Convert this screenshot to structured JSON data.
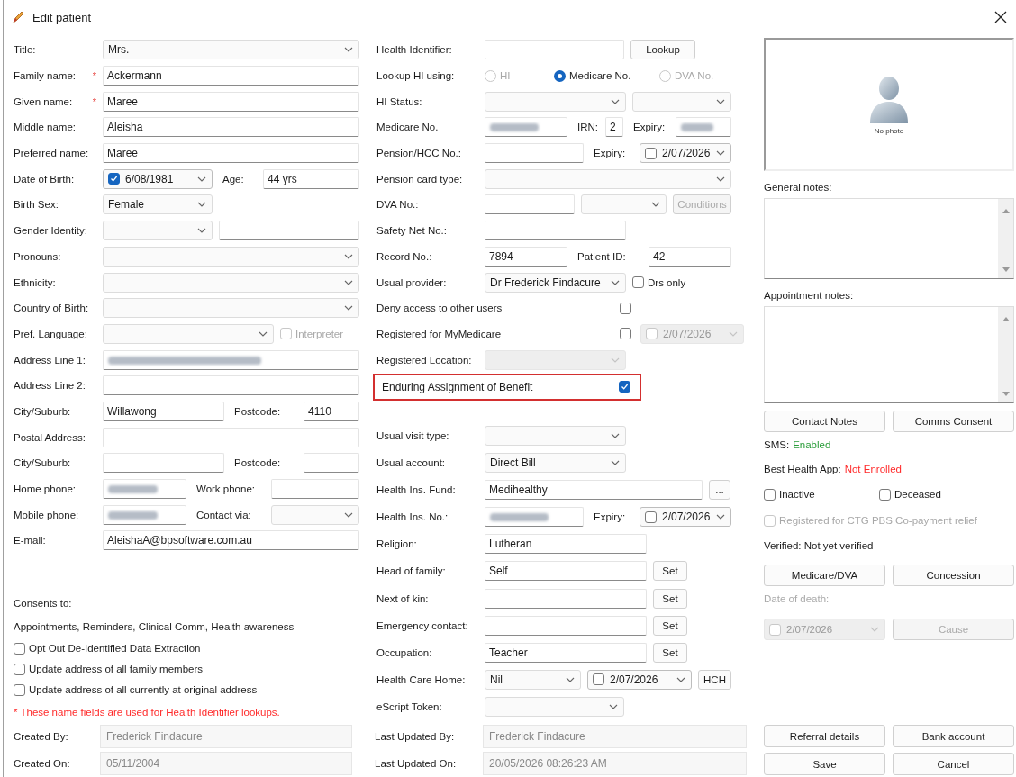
{
  "window": {
    "title": "Edit patient"
  },
  "personal": {
    "rows": [
      {
        "label": "Title:",
        "items": [
          {
            "kind": "combo",
            "value": "Mrs."
          }
        ]
      },
      {
        "label": "Family name:",
        "marker": "*",
        "items": [
          {
            "kind": "text",
            "value": "Ackermann"
          }
        ]
      },
      {
        "label": "Given name:",
        "marker": "*",
        "items": [
          {
            "kind": "text",
            "value": "Maree"
          }
        ]
      },
      {
        "label": "Middle name:",
        "items": [
          {
            "kind": "text",
            "value": "Aleisha"
          }
        ]
      },
      {
        "label": "Preferred name:",
        "items": [
          {
            "kind": "text",
            "value": "Maree"
          }
        ]
      },
      {
        "label": "Date of Birth:",
        "items": [
          {
            "kind": "date",
            "checked": true,
            "value": "6/08/1981"
          },
          {
            "kind": "label",
            "text": "Age:"
          },
          {
            "kind": "text",
            "value": "44 yrs"
          }
        ]
      },
      {
        "label": "Birth Sex:",
        "items": [
          {
            "kind": "combo",
            "value": "Female"
          }
        ]
      },
      {
        "label": "Gender Identity:",
        "items": [
          {
            "kind": "combo"
          },
          {
            "kind": "text"
          }
        ]
      },
      {
        "label": "Pronouns:",
        "items": [
          {
            "kind": "combo"
          }
        ]
      },
      {
        "label": "Ethnicity:",
        "items": [
          {
            "kind": "combo"
          }
        ]
      },
      {
        "label": "Country of Birth:",
        "items": [
          {
            "kind": "combo"
          }
        ]
      },
      {
        "label": "Pref. Language:",
        "items": [
          {
            "kind": "combo"
          },
          {
            "kind": "check",
            "label": "Interpreter",
            "checked": false,
            "disabled": true
          }
        ]
      },
      {
        "label": "Address Line 1:",
        "items": [
          {
            "kind": "text",
            "redacted": true
          }
        ]
      },
      {
        "label": "Address Line 2:",
        "items": [
          {
            "kind": "text"
          }
        ]
      },
      {
        "label": "City/Suburb:",
        "items": [
          {
            "kind": "text",
            "value": "Willawong"
          },
          {
            "kind": "label",
            "text": "Postcode:"
          },
          {
            "kind": "text",
            "value": "4110"
          }
        ]
      },
      {
        "label": "Postal Address:",
        "items": [
          {
            "kind": "text"
          }
        ]
      },
      {
        "label": "City/Suburb:",
        "items": [
          {
            "kind": "text"
          },
          {
            "kind": "label",
            "text": "Postcode:"
          },
          {
            "kind": "text"
          }
        ]
      },
      {
        "label": "Home phone:",
        "items": [
          {
            "kind": "text",
            "redacted": true
          },
          {
            "kind": "label",
            "text": "Work phone:"
          },
          {
            "kind": "text"
          }
        ]
      },
      {
        "label": "Mobile phone:",
        "items": [
          {
            "kind": "text",
            "redacted": true
          },
          {
            "kind": "label",
            "text": "Contact via:"
          },
          {
            "kind": "combo"
          }
        ]
      },
      {
        "label": "E-mail:",
        "items": [
          {
            "kind": "text",
            "value": "AleishaA@bpsoftware.com.au"
          }
        ]
      }
    ]
  },
  "consents": {
    "heading": "Consents to:",
    "text": "Appointments, Reminders, Clinical Comm, Health awareness",
    "options": [
      {
        "label": "Opt Out De-Identified Data Extraction",
        "checked": false
      },
      {
        "label": "Update address of all family members",
        "checked": false
      },
      {
        "label": "Update address of all currently at original address",
        "checked": false
      }
    ],
    "note": "* These name fields are used for Health Identifier lookups."
  },
  "identifiers": {
    "rows": [
      {
        "label": "Health Identifier:",
        "items": [
          {
            "kind": "text"
          },
          {
            "kind": "button",
            "label": "Lookup"
          }
        ]
      },
      {
        "label": "Lookup HI using:",
        "items": [
          {
            "kind": "radio",
            "label": "HI",
            "selected": false,
            "disabled": true
          },
          {
            "kind": "radio",
            "label": "Medicare No.",
            "selected": true
          },
          {
            "kind": "radio",
            "label": "DVA No.",
            "selected": false,
            "disabled": true
          }
        ]
      },
      {
        "label": "HI Status:",
        "items": [
          {
            "kind": "combo"
          },
          {
            "kind": "combo"
          }
        ]
      },
      {
        "label": "Medicare No.",
        "items": [
          {
            "kind": "text",
            "redacted": true
          },
          {
            "kind": "label",
            "text": "IRN:"
          },
          {
            "kind": "text",
            "value": "2"
          },
          {
            "kind": "label",
            "text": "Expiry:"
          },
          {
            "kind": "text",
            "redacted": true
          }
        ]
      },
      {
        "label": "Pension/HCC No.:",
        "items": [
          {
            "kind": "text"
          },
          {
            "kind": "label",
            "text": "Expiry:"
          },
          {
            "kind": "date",
            "checked": false,
            "value": "2/07/2026"
          }
        ]
      },
      {
        "label": "Pension card type:",
        "items": [
          {
            "kind": "combo"
          }
        ]
      },
      {
        "label": "DVA No.:",
        "items": [
          {
            "kind": "text"
          },
          {
            "kind": "combo"
          },
          {
            "kind": "button",
            "label": "Conditions",
            "disabled": true
          }
        ]
      },
      {
        "label": "Safety Net No.:",
        "items": [
          {
            "kind": "text"
          }
        ]
      },
      {
        "label": "Record No.:",
        "items": [
          {
            "kind": "text",
            "value": "7894"
          },
          {
            "kind": "label",
            "text": "Patient ID:"
          },
          {
            "kind": "text",
            "value": "42"
          }
        ]
      },
      {
        "label": "Usual provider:",
        "items": [
          {
            "kind": "combo",
            "value": "Dr Frederick Findacure"
          },
          {
            "kind": "check",
            "label": "Drs only",
            "checked": false
          }
        ]
      },
      {
        "label": "Deny access to other users",
        "items": [
          {
            "kind": "check",
            "checked": false
          }
        ]
      },
      {
        "label": "Registered for MyMedicare",
        "items": [
          {
            "kind": "check",
            "checked": false
          },
          {
            "kind": "date",
            "checked": false,
            "value": "2/07/2026",
            "disabled": true
          }
        ]
      },
      {
        "label": "Registered Location:",
        "items": [
          {
            "kind": "combo",
            "disabled": true
          }
        ]
      }
    ]
  },
  "benefit": {
    "label": "Enduring Assignment of Benefit",
    "checked": true,
    "highlighted": true
  },
  "preferences": {
    "rows": [
      {
        "label": "Usual visit type:",
        "items": [
          {
            "kind": "combo"
          }
        ]
      },
      {
        "label": "Usual account:",
        "items": [
          {
            "kind": "combo",
            "value": "Direct Bill"
          }
        ]
      },
      {
        "label": "Health Ins. Fund:",
        "items": [
          {
            "kind": "text",
            "value": "Medihealthy"
          },
          {
            "kind": "button",
            "label": "..."
          }
        ]
      },
      {
        "label": "Health Ins. No.:",
        "items": [
          {
            "kind": "text",
            "redacted": true
          },
          {
            "kind": "label",
            "text": "Expiry:"
          },
          {
            "kind": "date",
            "checked": false,
            "value": "2/07/2026"
          }
        ]
      },
      {
        "label": "Religion:",
        "items": [
          {
            "kind": "text",
            "value": "Lutheran"
          }
        ]
      },
      {
        "label": "Head of family:",
        "items": [
          {
            "kind": "text",
            "value": "Self"
          },
          {
            "kind": "button",
            "label": "Set"
          }
        ]
      },
      {
        "label": "Next of kin:",
        "items": [
          {
            "kind": "text"
          },
          {
            "kind": "button",
            "label": "Set"
          }
        ]
      },
      {
        "label": "Emergency contact:",
        "items": [
          {
            "kind": "text"
          },
          {
            "kind": "button",
            "label": "Set"
          }
        ]
      },
      {
        "label": "Occupation:",
        "items": [
          {
            "kind": "text",
            "value": "Teacher"
          },
          {
            "kind": "button",
            "label": "Set"
          }
        ]
      },
      {
        "label": "Health Care Home:",
        "items": [
          {
            "kind": "combo",
            "value": "Nil"
          },
          {
            "kind": "date",
            "checked": false,
            "value": "2/07/2026"
          },
          {
            "kind": "button",
            "label": "HCH"
          }
        ]
      },
      {
        "label": "eScript Token:",
        "items": [
          {
            "kind": "combo"
          }
        ]
      }
    ]
  },
  "side": {
    "photo": {
      "caption": "No photo"
    },
    "general_notes": {
      "label": "General notes:"
    },
    "appointment_notes": {
      "label": "Appointment notes:"
    },
    "note_buttons": [
      "Contact Notes",
      "Comms Consent"
    ],
    "statuses": [
      {
        "label": "SMS:",
        "value": "Enabled",
        "color": "#2a9d3a"
      },
      {
        "label": "Best Health App:",
        "value": "Not Enrolled",
        "color": "#ff2a2a"
      }
    ],
    "flags": [
      {
        "label": "Inactive",
        "checked": false
      },
      {
        "label": "Deceased",
        "checked": false
      }
    ],
    "ctg": {
      "label": "Registered for CTG PBS Co-payment relief",
      "checked": false,
      "disabled": true
    },
    "verified": "Verified: Not yet verified",
    "verify_buttons": [
      "Medicare/DVA",
      "Concession"
    ],
    "date_of_death": {
      "label": "Date of death:",
      "checked": false,
      "value": "2/07/2026",
      "disabled": true
    },
    "cause_button": {
      "label": "Cause",
      "disabled": true
    }
  },
  "record_info": [
    {
      "label": "Created By:",
      "value": "Frederick Findacure"
    },
    {
      "label": "Created On:",
      "value": "05/11/2004"
    }
  ],
  "update_info": [
    {
      "label": "Last Updated By:",
      "value": "Frederick Findacure"
    },
    {
      "label": "Last Updated On:",
      "value": "20/05/2026 08:26:23 AM"
    }
  ],
  "actions": [
    "Referral details",
    "Bank account",
    "Save",
    "Cancel"
  ]
}
